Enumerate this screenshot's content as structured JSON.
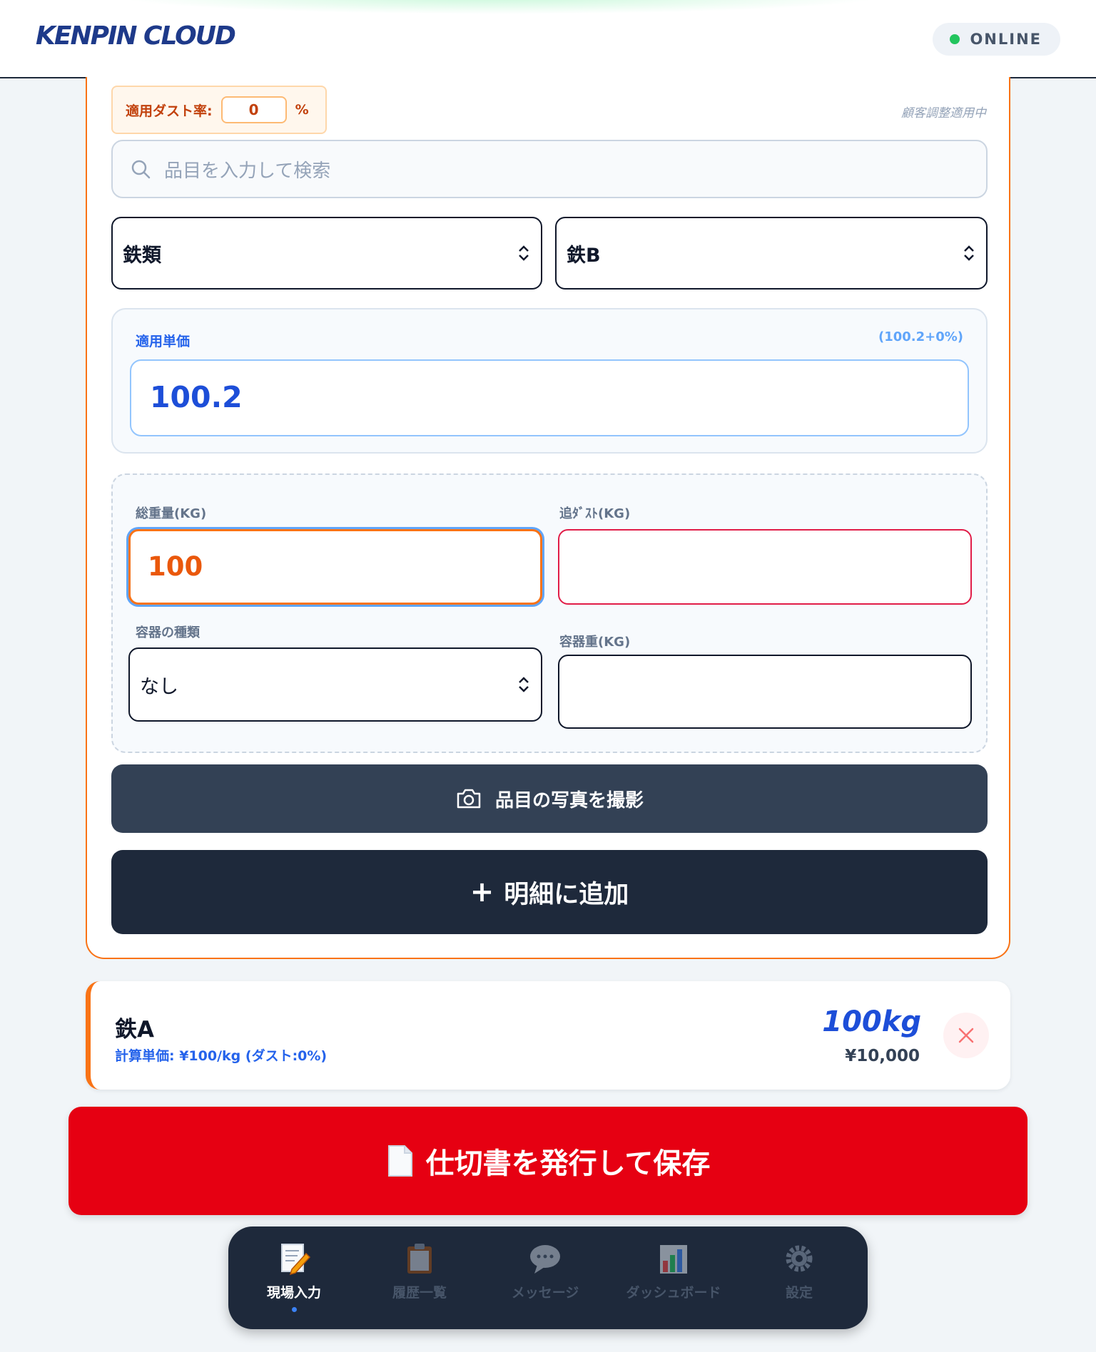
{
  "header": {
    "logo": "KENPIN CLOUD",
    "status": "ONLINE"
  },
  "form": {
    "dust_rate_label": "適用ダスト率:",
    "dust_rate_value": "0",
    "dust_rate_unit": "%",
    "adjust_note": "顧客調整適用中",
    "search_placeholder": "品目を入力して検索",
    "category_select": "鉄類",
    "item_select": "鉄B",
    "price_label": "適用単価",
    "price_formula": "(100.2+0%)",
    "price_value": "100.2",
    "gross_weight_label": "総重量(KG)",
    "gross_weight_value": "100",
    "extra_dust_label": "追ﾀﾞｽﾄ(KG)",
    "container_type_label": "容器の種類",
    "container_type_value": "なし",
    "container_weight_label": "容器重(KG)",
    "photo_button": "品目の写真を撮影",
    "add_button": "明細に追加"
  },
  "line_items": [
    {
      "name": "鉄A",
      "detail": "計算単価: ¥100/kg (ダスト:0%)",
      "weight": "100kg",
      "amount": "¥10,000"
    }
  ],
  "issue_button": "仕切書を発行して保存",
  "nav": {
    "items": [
      {
        "label": "現場入力",
        "icon": "memo-pencil-icon",
        "active": true
      },
      {
        "label": "履歴一覧",
        "icon": "clipboard-icon",
        "active": false
      },
      {
        "label": "メッセージ",
        "icon": "speech-bubble-icon",
        "active": false
      },
      {
        "label": "ダッシュボード",
        "icon": "bar-chart-icon",
        "active": false
      },
      {
        "label": "設定",
        "icon": "gear-icon",
        "active": false
      }
    ]
  },
  "colors": {
    "accent_orange": "#f97316",
    "primary_blue": "#1d4ed8",
    "issue_red": "#e60012",
    "nav_dark": "#1e293b"
  }
}
